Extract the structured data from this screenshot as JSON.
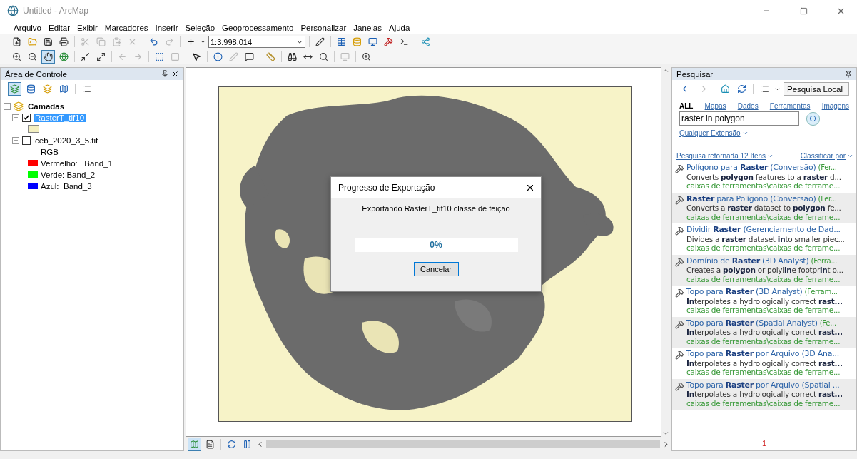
{
  "window": {
    "title": "Untitled - ArcMap"
  },
  "menu": [
    "Arquivo",
    "Editar",
    "Exibir",
    "Marcadores",
    "Inserir",
    "Seleção",
    "Geoprocessamento",
    "Personalizar",
    "Janelas",
    "Ajuda"
  ],
  "scale": {
    "value": "1:3.998.014"
  },
  "control_panel": {
    "title": "Área de Controle",
    "tree": [
      {
        "label": "Camadas",
        "kind": "group",
        "expanded": true,
        "children": [
          {
            "label": "RasterT_tif10",
            "kind": "layer",
            "expanded": true,
            "checked": true,
            "selected": true,
            "children": [
              {
                "kind": "swatch",
                "color": "#f3efc0"
              }
            ]
          },
          {
            "label": "ceb_2020_3_5.tif",
            "kind": "layer",
            "expanded": true,
            "checked": false,
            "selected": false,
            "children": [
              {
                "kind": "heading",
                "label": "RGB"
              },
              {
                "kind": "band",
                "label": "Vermelho:   Band_1",
                "color": "#ff0000"
              },
              {
                "kind": "band",
                "label": "Verde: Band_2",
                "color": "#00ff00"
              },
              {
                "kind": "band",
                "label": "Azul:  Band_3",
                "color": "#0000ff"
              }
            ]
          }
        ]
      }
    ]
  },
  "dialog": {
    "title": "Progresso de Exportação",
    "message": "Exportando RasterT_tif10 classe de feição",
    "progress": {
      "level": 0,
      "reading": "0%"
    },
    "button": "Cancelar"
  },
  "search_panel": {
    "title": "Pesquisar",
    "scope": "Pesquisa Local",
    "filters": [
      {
        "label": "ALL",
        "selected": true
      },
      {
        "label": "Mapas",
        "selected": false
      },
      {
        "label": "Dados",
        "selected": false
      },
      {
        "label": "Ferramentas",
        "selected": false
      },
      {
        "label": "Imagens",
        "selected": false
      }
    ],
    "query": "raster in polygon",
    "extent": "Qualquer Extensão",
    "summary": "Pesquisa retornada 12 Itens",
    "sort": "Classificar por",
    "results": [
      {
        "title": "Polígono para **Raster** (Conversão)",
        "toolbox": "(Fer...",
        "description": "Converts **polygon** features to a **raster** d...",
        "path": "caixas de ferramentas\\caixas de ferrame..."
      },
      {
        "title": "**Raster** para Polígono (Conversão)",
        "toolbox": "(Fer...",
        "description": "Converts a **raster** dataset to **polygon** fe...",
        "path": "caixas de ferramentas\\caixas de ferrame..."
      },
      {
        "title": "Dividir **Raster** (Gerenciamento de Dad...",
        "description": "Divides a **raster** dataset **in**to smaller piec...",
        "path": "caixas de ferramentas\\caixas de ferrame..."
      },
      {
        "title": "Domínio de **Raster** (3D Analyst)",
        "toolbox": "(Ferra...",
        "description": "Creates a **polygon** or polyl**in**e footpr**in**t o...",
        "path": "caixas de ferramentas\\caixas de ferrame..."
      },
      {
        "title": "Topo para **Raster** (3D Analyst)",
        "toolbox": "(Ferram...",
        "description": "**In**terpolates a hydrologically correct **rast...**",
        "path": "caixas de ferramentas\\caixas de ferrame..."
      },
      {
        "title": "Topo para **Raster** (Spatial Analyst)",
        "toolbox": "(Fe...",
        "description": "**In**terpolates a hydrologically correct **rast...**",
        "path": "caixas de ferramentas\\caixas de ferrame..."
      },
      {
        "title": "Topo para **Raster** por Arquivo (3D Ana...",
        "description": "**In**terpolates a hydrologically correct **rast...**",
        "path": "caixas de ferramentas\\caixas de ferrame..."
      },
      {
        "title": "Topo para **Raster** por Arquivo (Spatial ...",
        "description": "**In**terpolates a hydrologically correct **rast...**",
        "path": "caixas de ferramentas\\caixas de ferrame..."
      }
    ],
    "page": "1"
  }
}
